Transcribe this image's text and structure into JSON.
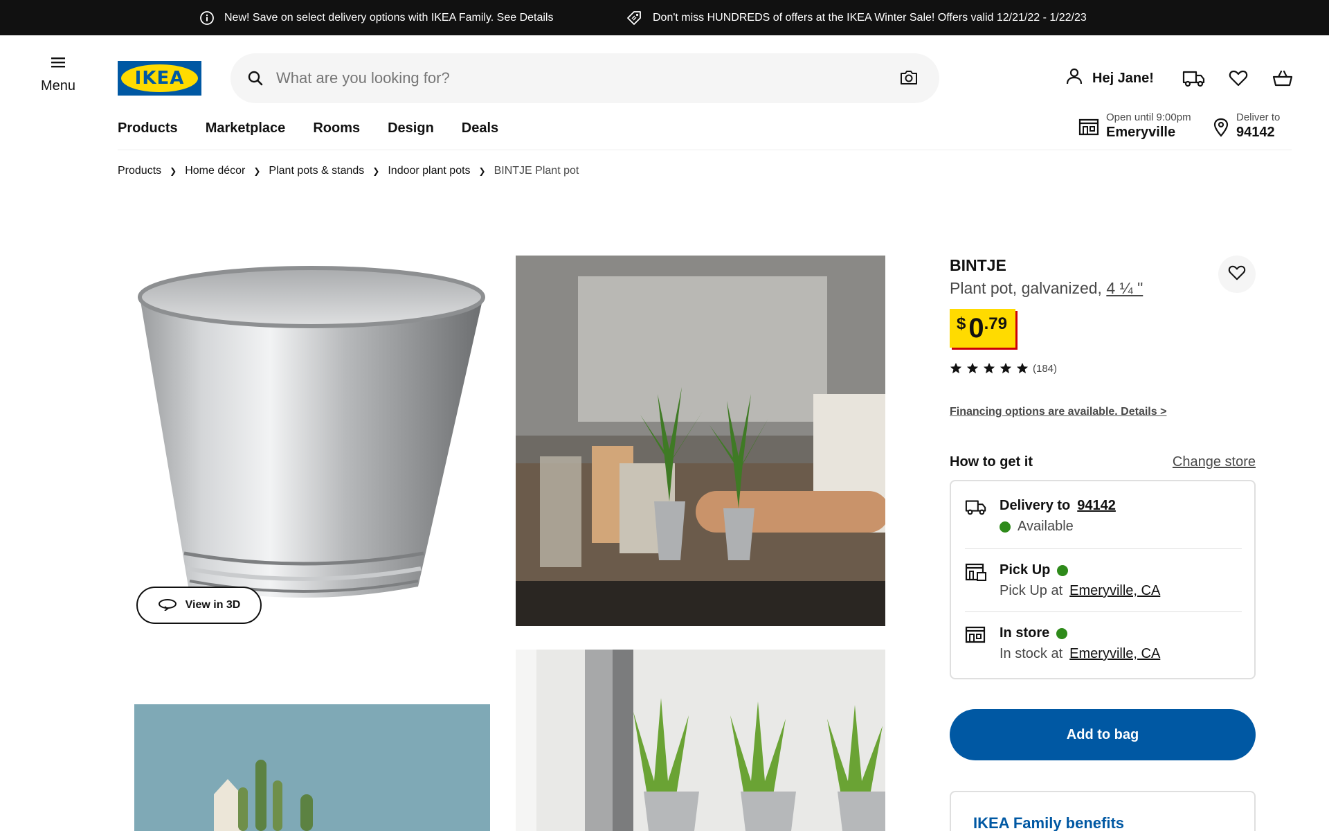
{
  "promo_bar": {
    "left_text": "New! Save on select delivery options with IKEA Family. See Details",
    "right_text": "Don't miss HUNDREDS of offers at the IKEA Winter Sale! Offers valid 12/21/22 - 1/22/23",
    "left_icon": "info-icon",
    "right_icon": "tag-icon"
  },
  "header": {
    "menu_label": "Menu",
    "logo_text": "IKEA",
    "search_placeholder": "What are you looking for?",
    "greeting": "Hej Jane!",
    "icons": [
      "hamburger-icon",
      "search-icon",
      "camera-icon",
      "user-icon",
      "truck-icon",
      "heart-icon",
      "basket-icon"
    ]
  },
  "nav": {
    "items": [
      "Products",
      "Marketplace",
      "Rooms",
      "Design",
      "Deals"
    ]
  },
  "store": {
    "open_label": "Open until 9:00pm",
    "name": "Emeryville",
    "deliver_label": "Deliver to",
    "zip": "94142"
  },
  "breadcrumb": {
    "items": [
      "Products",
      "Home décor",
      "Plant pots & stands",
      "Indoor plant pots"
    ],
    "current": "BINTJE Plant pot"
  },
  "gallery": {
    "view_3d_label": "View in 3D"
  },
  "product": {
    "name": "BINTJE",
    "description": "Plant pot, galvanized,",
    "size": "4 ¼ \"",
    "price": {
      "currency": "$",
      "integer": "0",
      "decimal": ".79"
    },
    "rating": {
      "stars": 5,
      "count_label": "(184)"
    },
    "financing_text": "Financing options are available. Details >",
    "how_to_get": "How to get it",
    "change_store": "Change store"
  },
  "fulfillment": {
    "delivery": {
      "title": "Delivery to",
      "zip": "94142",
      "status": "Available"
    },
    "pickup": {
      "title": "Pick Up",
      "prefix": "Pick Up at",
      "location": "Emeryville, CA"
    },
    "in_store": {
      "title": "In store",
      "prefix": "In stock at",
      "location": "Emeryville, CA"
    },
    "status_color": "#2e8a1a"
  },
  "actions": {
    "add_to_bag": "Add to bag",
    "family_benefits": "IKEA Family benefits"
  },
  "colors": {
    "brand_blue": "#0058a3",
    "brand_yellow": "#ffdb00",
    "price_shadow": "#cc0008",
    "topbar": "#111111"
  }
}
